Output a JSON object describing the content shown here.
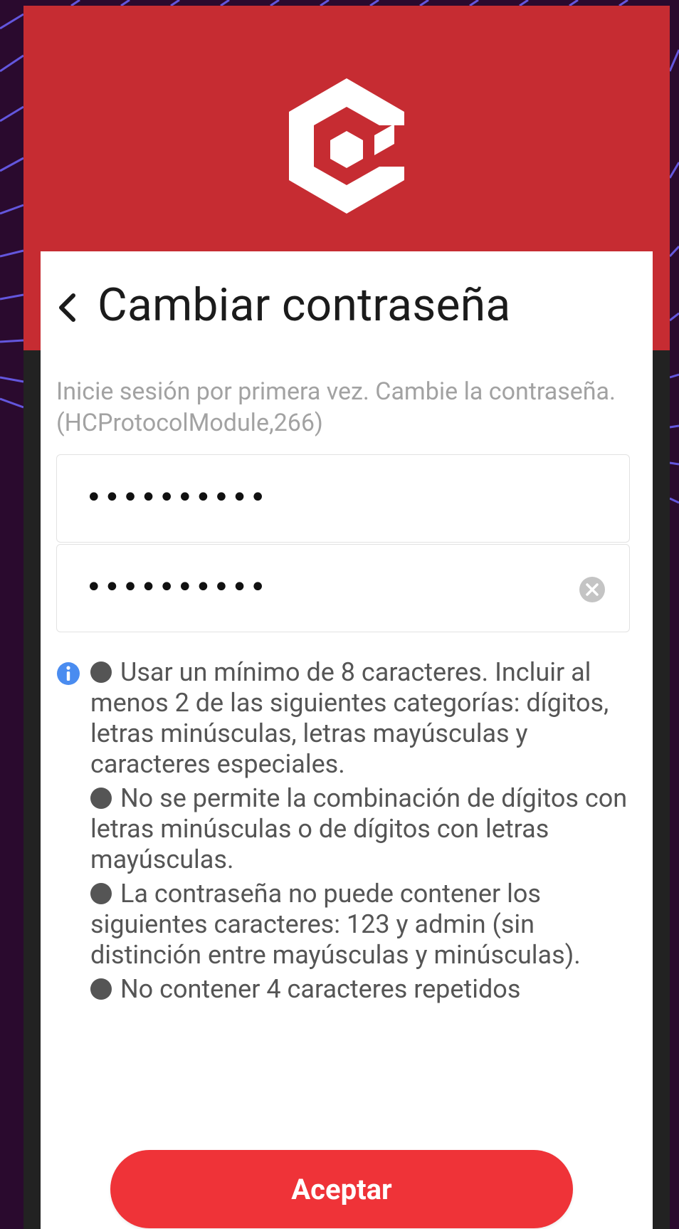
{
  "screen": {
    "title": "Cambiar contraseña",
    "subtitle": "Inicie sesión por primera vez. Cambie la contraseña. (HCProtocolModule,266)"
  },
  "form": {
    "password_new": "••••••••••",
    "password_confirm": "••••••••••"
  },
  "rules": [
    "Usar un mínimo de 8 caracteres. Incluir al menos 2 de las siguientes categorías: dígitos, letras minúsculas, letras mayúsculas y caracteres especiales.",
    "No se permite la combinación de dígitos con letras minúsculas o de dígitos con letras mayúsculas.",
    "La contraseña no puede contener los siguientes caracteres: 123 y admin (sin distinción entre mayúsculas y minúsculas).",
    "No contener 4 caracteres repetidos"
  ],
  "actions": {
    "accept_label": "Aceptar"
  },
  "icons": {
    "logo": "hexagon-logo-icon",
    "back": "chevron-left-icon",
    "clear": "clear-circle-icon",
    "info": "info-circle-icon"
  },
  "colors": {
    "header": "#c62c32",
    "accent": "#ef3338",
    "info": "#4a8cf0",
    "background": "#2a0a2e"
  }
}
